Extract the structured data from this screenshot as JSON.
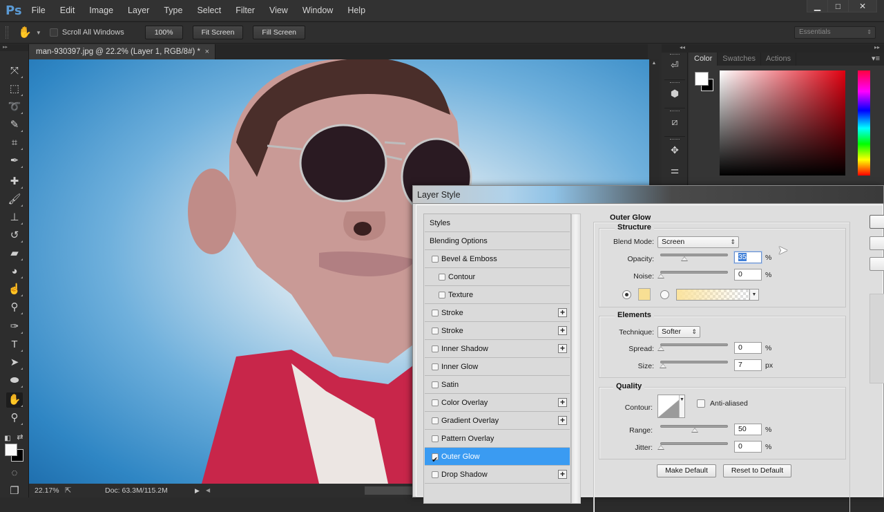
{
  "app": {
    "logo": "Ps",
    "menu": [
      "File",
      "Edit",
      "Image",
      "Layer",
      "Type",
      "Select",
      "Filter",
      "View",
      "Window",
      "Help"
    ],
    "window_controls": [
      "minimize-icon",
      "maximize-icon",
      "close-icon"
    ],
    "window_control_glyphs": [
      "▁",
      "□",
      "✕"
    ]
  },
  "options_bar": {
    "tool_icon": "hand-icon",
    "scroll_all_windows_label": "Scroll All Windows",
    "scroll_all_windows_checked": false,
    "buttons": [
      "100%",
      "Fit Screen",
      "Fill Screen"
    ],
    "workspace": "Essentials"
  },
  "document": {
    "tab_title": "man-930397.jpg @ 22.2% (Layer 1, RGB/8#) *",
    "close_glyph": "×"
  },
  "toolbar": {
    "tools": [
      {
        "name": "move-tool",
        "glyph": "⤧"
      },
      {
        "name": "marquee-tool",
        "glyph": "⬚"
      },
      {
        "name": "lasso-tool",
        "glyph": "➰"
      },
      {
        "name": "quick-selection-tool",
        "glyph": "✎"
      },
      {
        "name": "crop-tool",
        "glyph": "⌗"
      },
      {
        "name": "eyedropper-tool",
        "glyph": "✒"
      },
      {
        "name": "healing-brush-tool",
        "glyph": "✚"
      },
      {
        "name": "brush-tool",
        "glyph": "🖌"
      },
      {
        "name": "clone-stamp-tool",
        "glyph": "⊥"
      },
      {
        "name": "history-brush-tool",
        "glyph": "↺"
      },
      {
        "name": "eraser-tool",
        "glyph": "▰"
      },
      {
        "name": "paint-bucket-tool",
        "glyph": "◕"
      },
      {
        "name": "smudge-tool",
        "glyph": "☝"
      },
      {
        "name": "dodge-tool",
        "glyph": "⚲"
      },
      {
        "name": "pen-tool",
        "glyph": "✑"
      },
      {
        "name": "type-tool",
        "glyph": "T"
      },
      {
        "name": "path-selection-tool",
        "glyph": "➤"
      },
      {
        "name": "ellipse-tool",
        "glyph": "⬬"
      },
      {
        "name": "hand-tool",
        "glyph": "✋",
        "active": true
      },
      {
        "name": "zoom-tool",
        "glyph": "⚲"
      }
    ],
    "default_colors_glyph": "◧",
    "swap_colors_glyph": "⇄",
    "quick_mask_glyph": "◌",
    "screen_mode_glyph": "❐",
    "foreground_color": "#fafafa",
    "background_color": "#000000"
  },
  "status_bar": {
    "zoom": "22.17%",
    "doc_info": "Doc: 63.3M/115.2M"
  },
  "side_icons": [
    "history-icon",
    "3d-icon",
    "paths-icon",
    "brush-presets-icon",
    "adjustments-icon"
  ],
  "side_icon_glyphs": [
    "⏎",
    "⬢",
    "⧄",
    "✥",
    "⚌"
  ],
  "color_panel": {
    "tabs": [
      "Color",
      "Swatches",
      "Actions"
    ],
    "active_tab": "Color",
    "menu_glyph": "▾≡",
    "foreground_color": "#ffffff",
    "background_color": "#000000",
    "hue_color": "#e00010"
  },
  "layer_style": {
    "title": "Layer Style",
    "styles": [
      {
        "label": "Styles",
        "checkbox": false,
        "indent": false,
        "plus": false
      },
      {
        "label": "Blending Options",
        "checkbox": false,
        "indent": false,
        "plus": false
      },
      {
        "label": "Bevel & Emboss",
        "checkbox": true,
        "checked": false,
        "indent": false,
        "plus": false
      },
      {
        "label": "Contour",
        "checkbox": true,
        "checked": false,
        "indent": true,
        "plus": false
      },
      {
        "label": "Texture",
        "checkbox": true,
        "checked": false,
        "indent": true,
        "plus": false
      },
      {
        "label": "Stroke",
        "checkbox": true,
        "checked": false,
        "indent": false,
        "plus": true
      },
      {
        "label": "Stroke",
        "checkbox": true,
        "checked": false,
        "indent": false,
        "plus": true
      },
      {
        "label": "Inner Shadow",
        "checkbox": true,
        "checked": false,
        "indent": false,
        "plus": true
      },
      {
        "label": "Inner Glow",
        "checkbox": true,
        "checked": false,
        "indent": false,
        "plus": false
      },
      {
        "label": "Satin",
        "checkbox": true,
        "checked": false,
        "indent": false,
        "plus": false
      },
      {
        "label": "Color Overlay",
        "checkbox": true,
        "checked": false,
        "indent": false,
        "plus": true
      },
      {
        "label": "Gradient Overlay",
        "checkbox": true,
        "checked": false,
        "indent": false,
        "plus": true
      },
      {
        "label": "Pattern Overlay",
        "checkbox": true,
        "checked": false,
        "indent": false,
        "plus": false
      },
      {
        "label": "Outer Glow",
        "checkbox": true,
        "checked": true,
        "indent": false,
        "plus": false,
        "selected": true
      },
      {
        "label": "Drop Shadow",
        "checkbox": true,
        "checked": false,
        "indent": false,
        "plus": true
      }
    ],
    "plus_glyph": "+",
    "section_title": "Outer Glow",
    "structure": {
      "title": "Structure",
      "blend_mode_label": "Blend Mode:",
      "blend_mode": "Screen",
      "opacity_label": "Opacity:",
      "opacity": "35",
      "opacity_fraction": 0.35,
      "noise_label": "Noise:",
      "noise": "0",
      "noise_fraction": 0,
      "percent": "%",
      "color_mode": "solid",
      "glow_color": "#f8df94"
    },
    "elements": {
      "title": "Elements",
      "technique_label": "Technique:",
      "technique": "Softer",
      "spread_label": "Spread:",
      "spread": "0",
      "spread_fraction": 0,
      "size_label": "Size:",
      "size": "7",
      "size_fraction": 0.027,
      "px": "px",
      "percent": "%"
    },
    "quality": {
      "title": "Quality",
      "contour_label": "Contour:",
      "anti_aliased_label": "Anti-aliased",
      "anti_aliased": false,
      "range_label": "Range:",
      "range": "50",
      "range_fraction": 0.5,
      "jitter_label": "Jitter:",
      "jitter": "0",
      "jitter_fraction": 0,
      "percent": "%"
    },
    "make_default": "Make Default",
    "reset_default": "Reset to Default"
  },
  "canvas_image": "caricature photo of man with aviator sunglasses and red jacket on blue background"
}
